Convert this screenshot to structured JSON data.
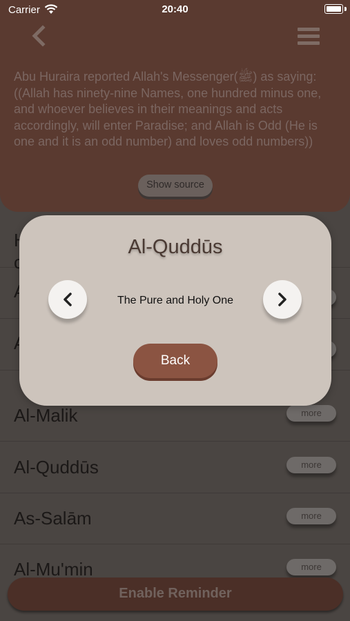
{
  "status_bar": {
    "carrier": "Carrier",
    "time": "20:40"
  },
  "header": {
    "hadith_text": "Abu Huraira reported Allah's Messenger(ﷺ) as saying: ((Allah has ninety-nine Names, one hundred minus one, and whoever believes in their meanings and acts accordingly, will enter Paradise; and Allah is Odd (He is one and it is an odd number) and loves odd numbers))",
    "show_source_label": "Show source"
  },
  "list": {
    "partial_top_1": "H",
    "partial_top_2": "c",
    "rows": [
      {
        "name": "A",
        "more": "more"
      },
      {
        "name": "A",
        "more": "more"
      },
      {
        "name": "Al-Malik",
        "more": "more"
      },
      {
        "name": "Al-Quddūs",
        "more": "more"
      },
      {
        "name": "As-Salām",
        "more": "more"
      },
      {
        "name": "Al-Mu'min",
        "more": "more"
      }
    ]
  },
  "reminder_label": "Enable Reminder",
  "modal": {
    "title": "Al-Quddūs",
    "meaning": "The Pure and Holy One",
    "back_label": "Back"
  },
  "colors": {
    "header_bg": "#5a3a30",
    "modal_bg": "#cdc4bc",
    "back_button": "#8b5442"
  },
  "icons": {
    "back": "chevron-left-icon",
    "menu": "hamburger-menu-icon",
    "prev": "chevron-left-icon",
    "next": "chevron-right-icon"
  }
}
